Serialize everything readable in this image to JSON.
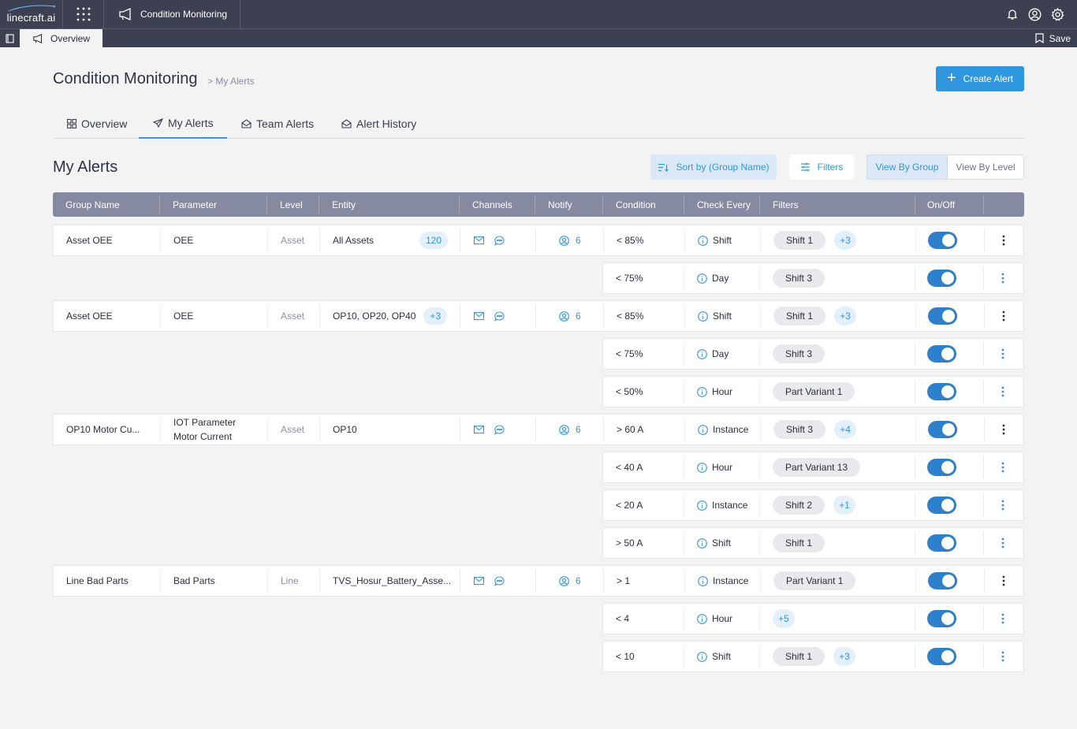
{
  "app": {
    "logo_text": "linecraft.ai",
    "module_title": "Condition Monitoring",
    "tab_label": "Overview",
    "save_label": "Save"
  },
  "header": {
    "title": "Condition Monitoring",
    "breadcrumb": "> My Alerts",
    "create_label": "Create Alert"
  },
  "tabs": [
    {
      "label": "Overview",
      "icon": "grid-icon"
    },
    {
      "label": "My Alerts",
      "icon": "send-icon",
      "active": true
    },
    {
      "label": "Team Alerts",
      "icon": "mail-open-icon"
    },
    {
      "label": "Alert History",
      "icon": "mail-open-icon"
    }
  ],
  "section": {
    "title": "My Alerts",
    "sort_label": "Sort by (Group Name)",
    "filters_label": "Filters",
    "view_group": "View By Group",
    "view_level": "View By Level"
  },
  "columns": [
    "Group Name",
    "Parameter",
    "Level",
    "Entity",
    "Channels",
    "Notify",
    "Condition",
    "Check Every",
    "Filters",
    "On/Off"
  ],
  "groups": [
    {
      "group": "Asset OEE",
      "parameter": "OEE",
      "level": "Asset",
      "entity": "All Assets",
      "entity_count": "120",
      "notify": "6",
      "rules": [
        {
          "condition": "< 85%",
          "check": "Shift",
          "filter": "Shift 1",
          "more": "+3",
          "on": true
        },
        {
          "condition": "< 75%",
          "check": "Day",
          "filter": "Shift 3",
          "more": "",
          "on": true
        }
      ]
    },
    {
      "group": "Asset OEE",
      "parameter": "OEE",
      "level": "Asset",
      "entity": "OP10, OP20, OP40",
      "entity_count": "+3",
      "notify": "6",
      "rules": [
        {
          "condition": "< 85%",
          "check": "Shift",
          "filter": "Shift 1",
          "more": "+3",
          "on": true
        },
        {
          "condition": "< 75%",
          "check": "Day",
          "filter": "Shift 3",
          "more": "",
          "on": true
        },
        {
          "condition": "< 50%",
          "check": "Hour",
          "filter": "Part Variant 1",
          "more": "",
          "on": true
        }
      ]
    },
    {
      "group": "OP10 Motor Cu...",
      "parameter": "IOT Parameter",
      "parameter2": "Motor Current",
      "level": "Asset",
      "entity": "OP10",
      "entity_count": "",
      "notify": "6",
      "rules": [
        {
          "condition": "> 60 A",
          "check": "Instance",
          "filter": "Shift 3",
          "more": "+4",
          "on": true
        },
        {
          "condition": "< 40 A",
          "check": "Hour",
          "filter": "Part Variant 13",
          "more": "",
          "on": true
        },
        {
          "condition": "< 20 A",
          "check": "Instance",
          "filter": "Shift 2",
          "more": "+1",
          "on": true
        },
        {
          "condition": "> 50 A",
          "check": "Shift",
          "filter": "Shift 1",
          "more": "",
          "on": true
        }
      ]
    },
    {
      "group": "Line Bad Parts",
      "parameter": "Bad Parts",
      "level": "Line",
      "entity": "TVS_Hosur_Battery_Asse...",
      "entity_count": "",
      "notify": "6",
      "rules": [
        {
          "condition": "> 1",
          "check": "Instance",
          "filter": "Part Variant 1",
          "more": "",
          "on": true
        },
        {
          "condition": "< 4",
          "check": "Hour",
          "filter": "",
          "more": "+5",
          "on": true
        },
        {
          "condition": "< 10",
          "check": "Shift",
          "filter": "Shift 1",
          "more": "+3",
          "on": true
        }
      ]
    }
  ]
}
